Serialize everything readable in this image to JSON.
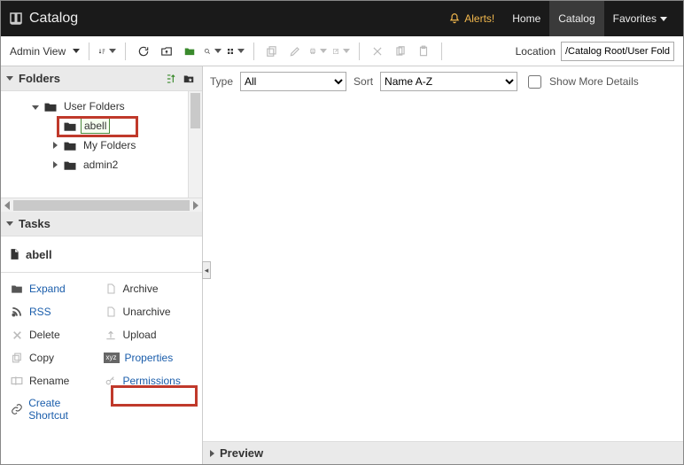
{
  "header": {
    "title": "Catalog",
    "alerts_label": "Alerts!",
    "nav": {
      "home": "Home",
      "catalog": "Catalog",
      "favorites": "Favorites"
    }
  },
  "toolbar": {
    "view_mode": "Admin View",
    "location_label": "Location",
    "location_value": "/Catalog Root/User Folders"
  },
  "filters": {
    "type_label": "Type",
    "type_value": "All",
    "sort_label": "Sort",
    "sort_value": "Name A-Z",
    "show_more_label": "Show More Details"
  },
  "folders": {
    "title": "Folders",
    "items": [
      {
        "label": "User Folders"
      },
      {
        "label": "abell"
      },
      {
        "label": "My Folders"
      },
      {
        "label": "admin2"
      }
    ]
  },
  "tasks": {
    "title": "Tasks",
    "selected": "abell",
    "items": {
      "expand": "Expand",
      "archive": "Archive",
      "rss": "RSS",
      "unarchive": "Unarchive",
      "delete": "Delete",
      "upload": "Upload",
      "copy": "Copy",
      "properties": "Properties",
      "rename": "Rename",
      "permissions": "Permissions",
      "shortcut": "Create Shortcut"
    }
  },
  "preview": {
    "title": "Preview"
  }
}
